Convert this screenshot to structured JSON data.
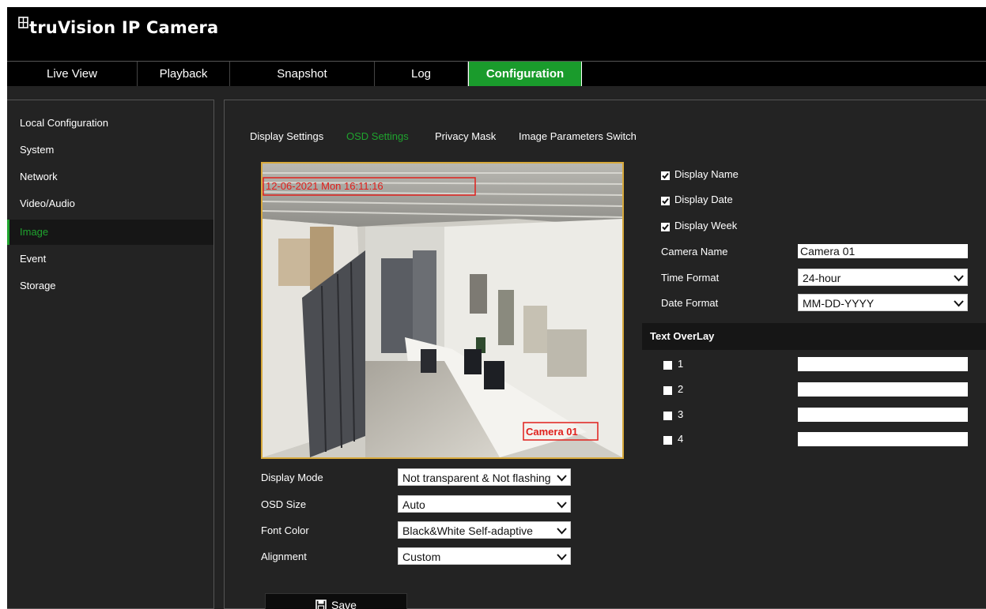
{
  "app": {
    "brand": "truVision IP Camera"
  },
  "nav": {
    "tabs": [
      {
        "label": "Live View"
      },
      {
        "label": "Playback"
      },
      {
        "label": "Snapshot"
      },
      {
        "label": "Log"
      },
      {
        "label": "Configuration",
        "active": true
      }
    ]
  },
  "sidebar": {
    "items": [
      {
        "label": "Local Configuration"
      },
      {
        "label": "System"
      },
      {
        "label": "Network"
      },
      {
        "label": "Video/Audio"
      },
      {
        "label": "Image",
        "active": true
      },
      {
        "label": "Event"
      },
      {
        "label": "Storage"
      }
    ]
  },
  "subtabs": [
    {
      "label": "Display Settings"
    },
    {
      "label": "OSD Settings",
      "active": true
    },
    {
      "label": "Privacy Mask"
    },
    {
      "label": "Image Parameters Switch"
    }
  ],
  "preview": {
    "osd_date_text": "12-06-2021 Mon 16:11:16",
    "osd_name_text": "Camera 01"
  },
  "osd": {
    "display_name_label": "Display Name",
    "display_name_checked": true,
    "display_date_label": "Display Date",
    "display_date_checked": true,
    "display_week_label": "Display Week",
    "display_week_checked": true,
    "camera_name_label": "Camera Name",
    "camera_name_value": "Camera 01",
    "time_format_label": "Time Format",
    "time_format_value": "24-hour",
    "date_format_label": "Date Format",
    "date_format_value": "MM-DD-YYYY"
  },
  "text_overlay": {
    "title": "Text OverLay",
    "items": [
      {
        "label": "1",
        "checked": false,
        "value": ""
      },
      {
        "label": "2",
        "checked": false,
        "value": ""
      },
      {
        "label": "3",
        "checked": false,
        "value": ""
      },
      {
        "label": "4",
        "checked": false,
        "value": ""
      }
    ]
  },
  "display": {
    "mode_label": "Display Mode",
    "mode_value": "Not transparent & Not flashing",
    "size_label": "OSD Size",
    "size_value": "Auto",
    "font_color_label": "Font Color",
    "font_color_value": "Black&White Self-adaptive",
    "alignment_label": "Alignment",
    "alignment_value": "Custom"
  },
  "actions": {
    "save_label": "Save"
  },
  "colors": {
    "accent": "#1a9b2c",
    "header_bg": "#000000",
    "panel_bg": "#232323",
    "preview_border": "#d7a93c",
    "osd_text": "#e0201c"
  }
}
